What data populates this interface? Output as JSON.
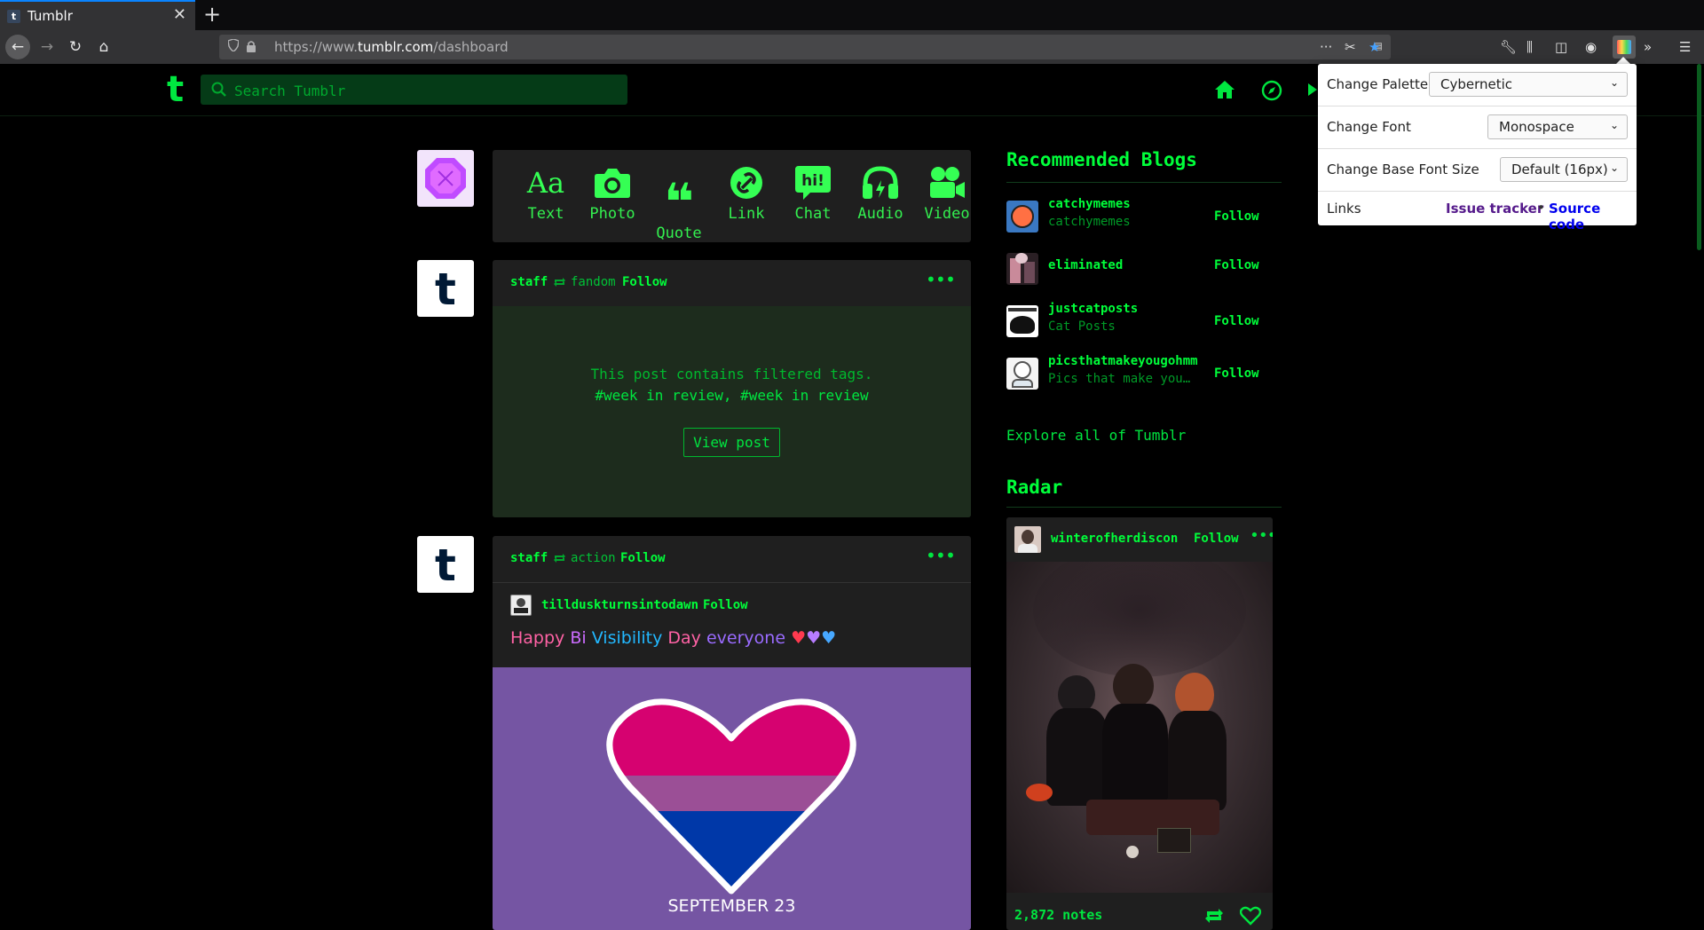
{
  "browser": {
    "tab_title": "Tumblr",
    "url_prefix": "https://www.",
    "url_domain": "tumblr.com",
    "url_path": "/dashboard"
  },
  "header": {
    "logo": "t",
    "search_placeholder": "Search Tumblr"
  },
  "post_types": [
    {
      "label": "Text",
      "icon": "text-icon"
    },
    {
      "label": "Photo",
      "icon": "camera-icon"
    },
    {
      "label": "Quote",
      "icon": "quote-icon"
    },
    {
      "label": "Link",
      "icon": "link-icon"
    },
    {
      "label": "Chat",
      "icon": "chat-icon"
    },
    {
      "label": "Audio",
      "icon": "headphones-icon"
    },
    {
      "label": "Video",
      "icon": "video-camera-icon"
    }
  ],
  "posts": [
    {
      "blog": "staff",
      "source": "fandom",
      "follow": "Follow",
      "filter_message": "This post contains filtered tags.",
      "filter_tags": "#week in review, #week in review",
      "view_post": "View post"
    },
    {
      "blog": "staff",
      "source": "action",
      "follow": "Follow",
      "reblog_blog": "tillduskturnsintodawn",
      "reblog_follow": "Follow",
      "rainbow_words": [
        "Happy",
        "Bi",
        "Visibility",
        "Day",
        "everyone"
      ],
      "rainbow_colors": [
        "#ff62a5",
        "#cc6cff",
        "#22b8ff",
        "#ff62a5",
        "#9a6bff"
      ],
      "image_caption": "SEPTEMBER 23"
    }
  ],
  "sidebar": {
    "recommended_title": "Recommended Blogs",
    "blogs": [
      {
        "name": "catchymemes",
        "desc": "catchymemes",
        "follow": "Follow"
      },
      {
        "name": "eliminated",
        "desc": "",
        "follow": "Follow"
      },
      {
        "name": "justcatposts",
        "desc": "Cat Posts",
        "follow": "Follow"
      },
      {
        "name": "picsthatmakeyougohmm",
        "desc": "Pics that make you…",
        "follow": "Follow"
      }
    ],
    "explore": "Explore all of Tumblr",
    "radar_title": "Radar",
    "radar": {
      "blog": "winterofherdiscon",
      "follow": "Follow",
      "notes": "2,872 notes"
    }
  },
  "extension_popup": {
    "palette_label": "Change Palette",
    "palette_value": "Cybernetic",
    "font_label": "Change Font",
    "font_value": "Monospace",
    "font_size_label": "Change Base Font Size",
    "font_size_value": "Default (16px)",
    "links_label": "Links",
    "issue_tracker": "Issue tracker",
    "separator": "•",
    "source_code": "Source code"
  },
  "colors": {
    "accent": "#00e640",
    "background": "#000000",
    "card": "#1f1f1f",
    "bi_pink": "#d60270",
    "bi_purple": "#9b4f96",
    "bi_blue": "#0038a8"
  }
}
